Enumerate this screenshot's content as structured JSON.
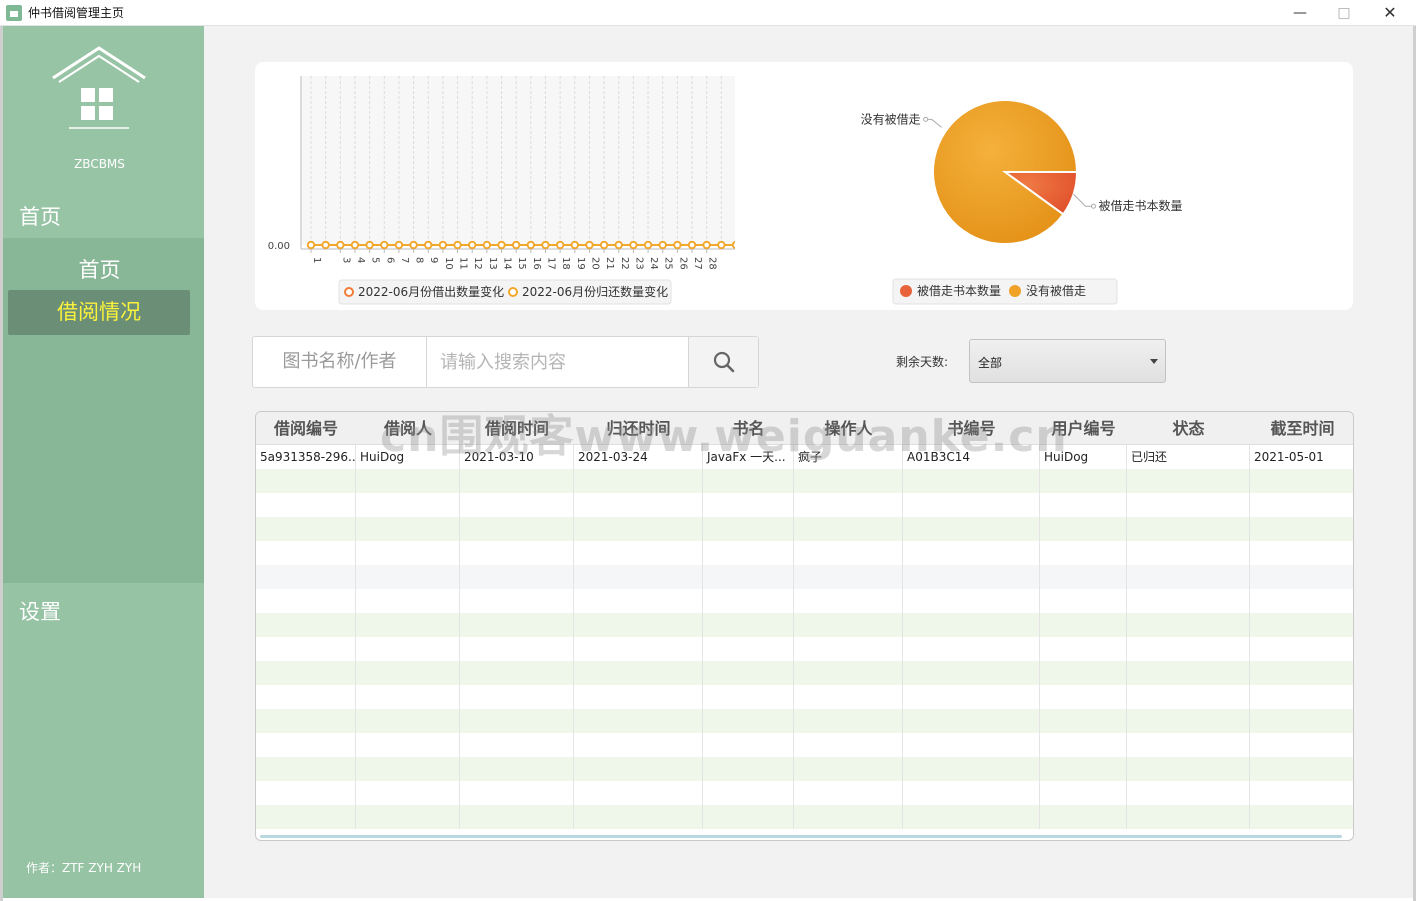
{
  "window": {
    "title": "仲书借阅管理主页",
    "min_icon": "minimize-icon",
    "max_icon": "maximize-icon",
    "close_icon": "close-icon"
  },
  "sidebar": {
    "app_name": "ZBCBMS",
    "home_header": "首页",
    "items": [
      {
        "label": "首页"
      },
      {
        "label": "借阅情况",
        "active": true
      }
    ],
    "settings": "设置",
    "author": "作者：ZTF ZYH ZYH",
    "colors": {
      "bg": "#95c3a4",
      "group": "#88b797",
      "active_bg": "#6a8f76",
      "active_text": "#fbf23c"
    }
  },
  "chart_data": [
    {
      "type": "line",
      "x": [
        "1",
        "2",
        "3",
        "4",
        "5",
        "6",
        "7",
        "8",
        "9",
        "10",
        "11",
        "12",
        "13",
        "14",
        "15",
        "16",
        "17",
        "18",
        "19",
        "20",
        "21",
        "22",
        "23",
        "24",
        "25",
        "26",
        "27",
        "28",
        "29",
        "30"
      ],
      "x_tick_labels": [
        "1",
        "3",
        "4",
        "5",
        "6",
        "7",
        "8",
        "9",
        "10",
        "11",
        "12",
        "13",
        "14",
        "15",
        "16",
        "17",
        "18",
        "19",
        "20",
        "21",
        "22",
        "23",
        "24",
        "25",
        "26",
        "27",
        "28",
        "30"
      ],
      "y_tick_labels": [
        "0.00"
      ],
      "ylim": [
        0,
        1
      ],
      "series": [
        {
          "name": "2022-06月份借出数量变化",
          "color": "#f07b37",
          "values": [
            0,
            0,
            0,
            0,
            0,
            0,
            0,
            0,
            0,
            0,
            0,
            0,
            0,
            0,
            0,
            0,
            0,
            0,
            0,
            0,
            0,
            0,
            0,
            0,
            0,
            0,
            0,
            0,
            0,
            0
          ]
        },
        {
          "name": "2022-06月份归还数量变化",
          "color": "#f1a82b",
          "values": [
            0,
            0,
            0,
            0,
            0,
            0,
            0,
            0,
            0,
            0,
            0,
            0,
            0,
            0,
            0,
            0,
            0,
            0,
            0,
            0,
            0,
            0,
            0,
            0,
            0,
            0,
            0,
            0,
            0,
            0
          ]
        }
      ],
      "grid": true,
      "legend": "bottom"
    },
    {
      "type": "pie",
      "slices": [
        {
          "name": "被借走书本数量",
          "value": 1,
          "color": "#e8623a"
        },
        {
          "name": "没有被借走",
          "value": 9,
          "color": "#f0a128"
        }
      ],
      "legend": "bottom"
    }
  ],
  "search": {
    "label": "图书名称/作者",
    "placeholder": "请输入搜索内容",
    "value": "",
    "icon": "search-icon"
  },
  "filter": {
    "label": "剩余天数:",
    "value": "全部"
  },
  "table": {
    "columns": [
      "借阅编号",
      "借阅人",
      "借阅时间",
      "归还时间",
      "书名",
      "操作人",
      "书编号",
      "用户编号",
      "状态",
      "截至时间"
    ],
    "rows": [
      [
        "5a931358-296...",
        "HuiDog",
        "2021-03-10",
        "2021-03-24",
        "JavaFx 一天...",
        "疯子",
        "A01B3C14",
        "HuiDog",
        "已归还",
        "2021-05-01"
      ]
    ]
  },
  "watermark": "cn围观客www.weiguanke.cn"
}
